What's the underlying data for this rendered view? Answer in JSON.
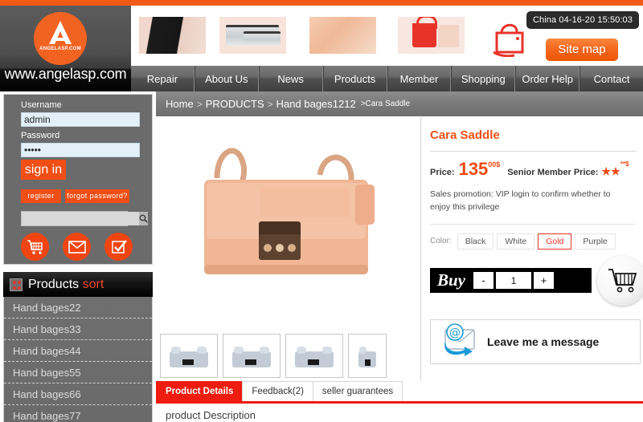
{
  "brand": {
    "logo_text": "ANGELASP.COM",
    "site_url": "www.angelasp.com"
  },
  "header": {
    "time_badge": "China 04-16-20 15:50:03",
    "sitemap_label": "Site map"
  },
  "nav": {
    "items": [
      {
        "label": "Repair"
      },
      {
        "label": "About Us"
      },
      {
        "label": "News"
      },
      {
        "label": "Products"
      },
      {
        "label": "Member"
      },
      {
        "label": "Shopping"
      },
      {
        "label": "Order Help"
      },
      {
        "label": "Contact"
      }
    ]
  },
  "login": {
    "username_label": "Username",
    "username_value": "admin",
    "username_placeholder": "",
    "password_label": "Password",
    "password_value": "•••••",
    "signin_label": "sign in",
    "register_label": "register",
    "forgot_label": "forgot password?",
    "search_value": "",
    "search_placeholder": ""
  },
  "sidebar": {
    "sort_title": "Products",
    "sort_accent": "sort",
    "products": [
      {
        "label": "Hand bages22"
      },
      {
        "label": "Hand bages33"
      },
      {
        "label": "Hand bages44"
      },
      {
        "label": "Hand bages55"
      },
      {
        "label": "Hand bages66"
      },
      {
        "label": "Hand bages77"
      }
    ]
  },
  "breadcrumb": {
    "home": "Home",
    "sep1": ">",
    "products": "PRODUCTS",
    "sep2": ">",
    "category": "Hand bages1212",
    "current": ">Cara Saddle"
  },
  "product": {
    "title": "Cara Saddle",
    "price_label": "Price:",
    "price_value": "135",
    "price_cents": "00$",
    "senior_label": "Senior Member Price:",
    "senior_value": "★★",
    "senior_sup": "**$",
    "promotion": "Sales promotion: VIP login to confirm whether to enjoy this privilege",
    "color_label": "Color:",
    "colors": [
      {
        "label": "Black",
        "selected": false
      },
      {
        "label": "White",
        "selected": false
      },
      {
        "label": "Gold",
        "selected": true
      },
      {
        "label": "Purple",
        "selected": false
      }
    ],
    "buy_label": "Buy",
    "qty_minus": "-",
    "qty_value": "1",
    "qty_plus": "+",
    "message_label": "Leave me a message"
  },
  "tabs": [
    {
      "label": "Product Details",
      "active": true
    },
    {
      "label": "Feedback(2)",
      "active": false
    },
    {
      "label": "seller guarantees",
      "active": false
    }
  ],
  "description": {
    "heading": "product Description"
  },
  "colors": {
    "orange": "#f04e14",
    "accent_red": "#ef1c10",
    "title_orange": "#ee4f14",
    "nav_gray": "#6a6a6a",
    "sidebar_gray": "#6b6b6b"
  }
}
